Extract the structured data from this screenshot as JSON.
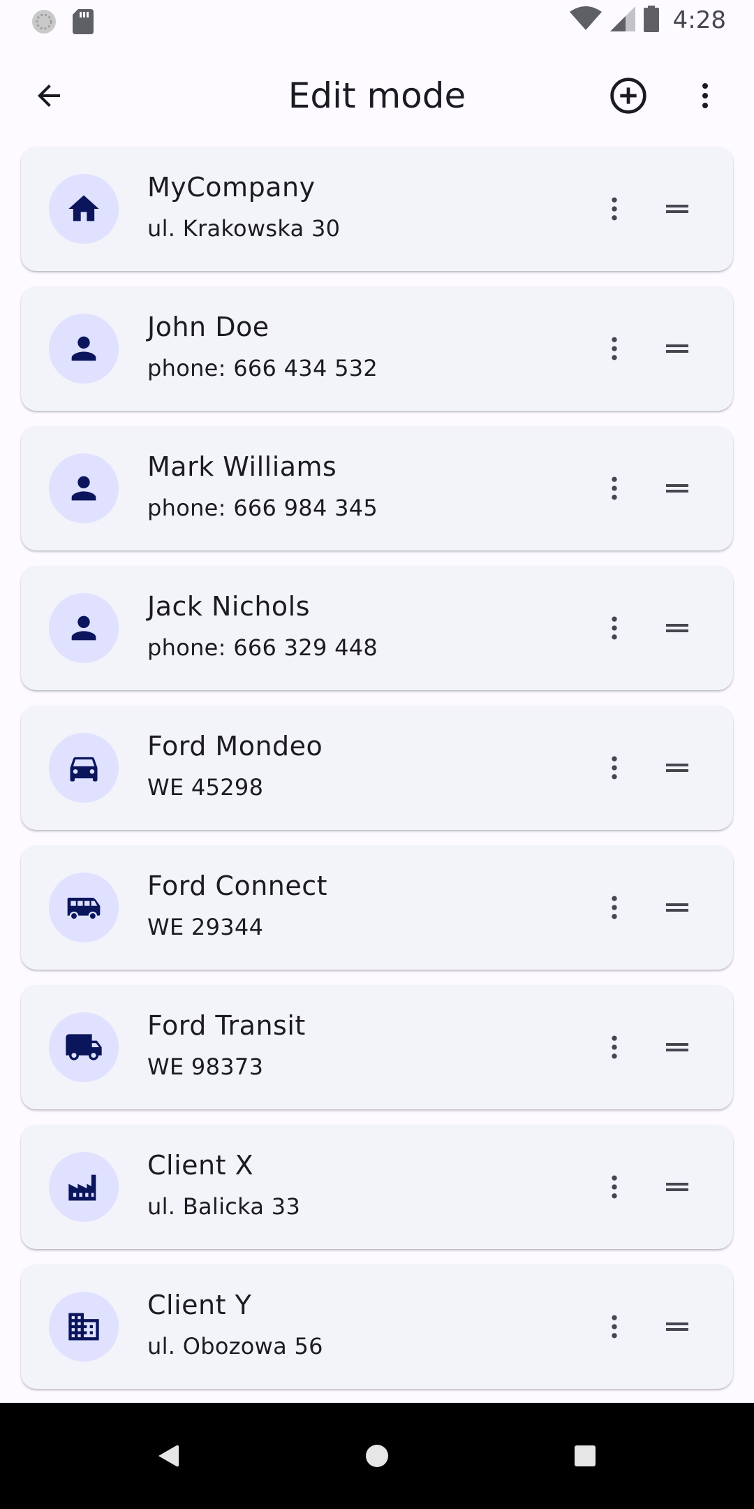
{
  "status_bar": {
    "time": "4:28"
  },
  "app_bar": {
    "title": "Edit mode"
  },
  "items": [
    {
      "title": "MyCompany",
      "subtitle": "ul. Krakowska 30",
      "icon": "home-icon"
    },
    {
      "title": "John Doe",
      "subtitle": "phone: 666 434 532",
      "icon": "person-icon"
    },
    {
      "title": "Mark Williams",
      "subtitle": "phone: 666 984 345",
      "icon": "person-icon"
    },
    {
      "title": "Jack Nichols",
      "subtitle": "phone: 666 329 448",
      "icon": "person-icon"
    },
    {
      "title": "Ford Mondeo",
      "subtitle": "WE 45298",
      "icon": "car-icon"
    },
    {
      "title": "Ford Connect",
      "subtitle": "WE 29344",
      "icon": "van-icon"
    },
    {
      "title": "Ford Transit",
      "subtitle": "WE 98373",
      "icon": "truck-icon"
    },
    {
      "title": "Client X",
      "subtitle": "ul. Balicka 33",
      "icon": "factory-icon"
    },
    {
      "title": "Client Y",
      "subtitle": "ul. Obozowa 56",
      "icon": "office-building-icon"
    }
  ],
  "colors": {
    "icon_primary": "#0a155c",
    "avatar_bg": "#dfe1ff",
    "card_bg": "#f3f3fa",
    "page_bg": "#fdfbff"
  }
}
